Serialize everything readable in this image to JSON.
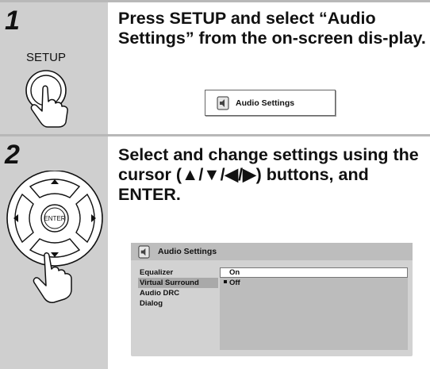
{
  "steps": [
    {
      "number": "1",
      "instruction": "Press SETUP and select “Audio Settings” from the on-screen dis-play.",
      "remote_button_label": "SETUP",
      "screen_item": {
        "icon": "speaker-icon",
        "label": "Audio Settings"
      }
    },
    {
      "number": "2",
      "instruction": "Select and change settings using the cursor (▲/▼/◀/▶) buttons, and ENTER.",
      "remote_center_label": "ENTER",
      "menu_screen": {
        "title": "Audio Settings",
        "icon": "speaker-icon",
        "menu_items": [
          "Equalizer",
          "Virtual Surround",
          "Audio DRC",
          "Dialog"
        ],
        "selected_menu_item": "Virtual Surround",
        "options": [
          "On",
          "Off"
        ],
        "highlighted_option": "On",
        "current_option": "Off"
      }
    }
  ],
  "colors": {
    "sidebar": "#cfcfcf",
    "rule": "#b8b8b8",
    "screen_bg": "#d2d2d2",
    "pane_bg": "#bcbcbc"
  }
}
